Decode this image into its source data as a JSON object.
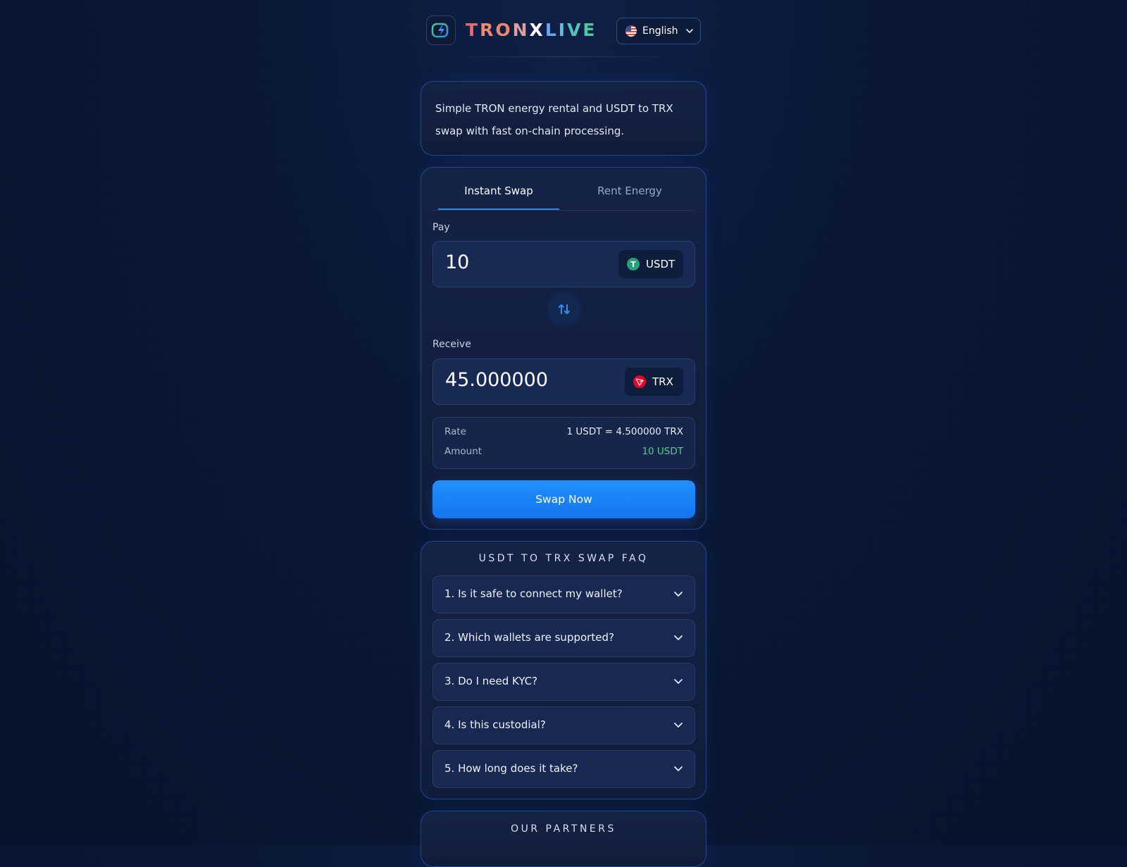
{
  "header": {
    "brand_letters": [
      "T",
      "R",
      "O",
      "N",
      "X",
      "L",
      "I",
      "V",
      "E"
    ],
    "language": "English",
    "logo_icon": "bolt-logo-icon",
    "flag_icon": "us-flag-icon"
  },
  "intro": {
    "text": "Simple TRON energy rental and USDT to TRX swap with fast on-chain processing."
  },
  "tabs": [
    {
      "label": "Instant Swap",
      "active": true
    },
    {
      "label": "Rent Energy",
      "active": false
    }
  ],
  "pay": {
    "label": "Pay",
    "amount": "10",
    "token": "USDT",
    "token_icon": "tether-icon",
    "token_color": "#26a17b"
  },
  "receive": {
    "label": "Receive",
    "amount": "45.000000",
    "token": "TRX",
    "token_icon": "tron-icon",
    "token_color": "#eb0029"
  },
  "info": {
    "rate_label": "Rate",
    "rate_value": "1 USDT = 4.500000 TRX",
    "amount_label": "Amount",
    "amount_value": "10 USDT"
  },
  "swap_button": "Swap Now",
  "faq": {
    "title": "USDT TO TRX SWAP FAQ",
    "items": [
      "1. Is it safe to connect my wallet?",
      "2. Which wallets are supported?",
      "3. Do I need KYC?",
      "4. Is this custodial?",
      "5. How long does it take?"
    ]
  },
  "partners": {
    "title": "OUR PARTNERS"
  },
  "colors": {
    "accent": "#1e88ff",
    "positive": "#4ed08a",
    "background": "#08142e"
  }
}
